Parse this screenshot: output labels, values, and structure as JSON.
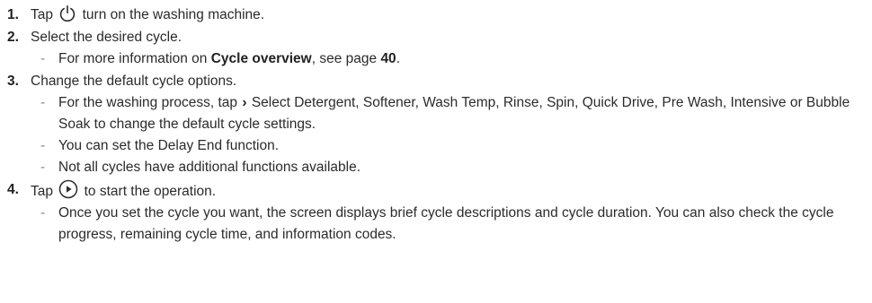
{
  "steps": [
    {
      "number": "1.",
      "before_icon": "Tap",
      "icon": "power-icon",
      "after_icon": "turn on the washing machine.",
      "subs": []
    },
    {
      "number": "2.",
      "text": "Select the desired cycle.",
      "subs": [
        {
          "prefix": "For more information on ",
          "bold1": "Cycle overview",
          "middle": ", see page ",
          "bold2": "40",
          "suffix": "."
        }
      ]
    },
    {
      "number": "3.",
      "text": "Change the default cycle options.",
      "subs": [
        {
          "before_icon": "For the washing process, tap",
          "icon": "chevron-right-icon",
          "after_icon": "Select Detergent, Softener, Wash Temp, Rinse, Spin, Quick Drive, Pre Wash, Intensive or Bubble Soak to change the default cycle settings."
        },
        {
          "text": "You can set the Delay End function."
        },
        {
          "text": "Not all cycles have additional functions available."
        }
      ]
    },
    {
      "number": "4.",
      "before_icon": "Tap",
      "icon": "play-icon",
      "after_icon": "to start the operation.",
      "subs": [
        {
          "text": "Once you set the cycle you want, the screen displays brief cycle descriptions and cycle duration. You can also check the cycle progress, remaining cycle time, and information codes."
        }
      ]
    }
  ],
  "dash_char": "-",
  "chevron_char": "›"
}
